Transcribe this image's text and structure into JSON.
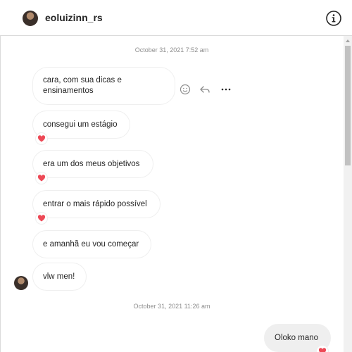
{
  "header": {
    "username": "eoluizinn_rs",
    "info_icon": "info-circle-icon"
  },
  "thread": {
    "timestamps": [
      "October 31, 2021 7:52 am",
      "October 31, 2021 11:26 am"
    ],
    "incoming_messages": [
      {
        "lines": [
          "cara, com sua dicas e",
          "ensinamentos"
        ],
        "liked": false
      },
      {
        "lines": [
          "consegui um estágio"
        ],
        "liked": true
      },
      {
        "lines": [
          "era um dos meus objetivos"
        ],
        "liked": true
      },
      {
        "lines": [
          "entrar o mais rápido possível"
        ],
        "liked": true
      },
      {
        "lines": [
          "e amanhã eu vou começar"
        ],
        "liked": false
      },
      {
        "lines": [
          "vlw men!"
        ],
        "liked": false
      }
    ],
    "outgoing_messages": [
      {
        "lines": [
          "Oloko mano"
        ],
        "liked": true
      }
    ],
    "hover_actions": [
      "smile-icon",
      "reply-icon",
      "more-icon"
    ]
  },
  "colors": {
    "heart": "#ed4956",
    "outgoing_bubble": "#efefef",
    "border": "#dbdbdb",
    "timestamp": "#8e8e8e"
  }
}
